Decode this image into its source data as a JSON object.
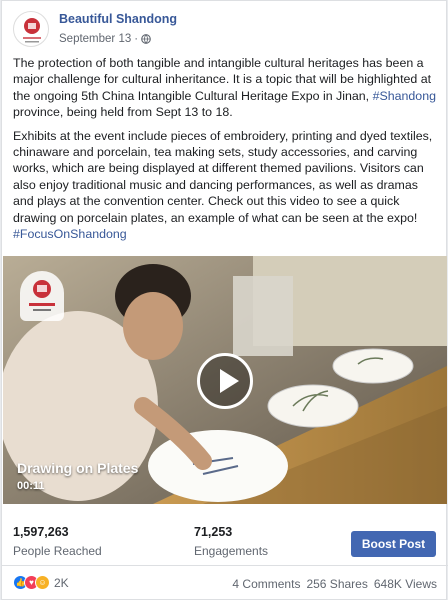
{
  "post": {
    "page_name": "Beautiful Shandong",
    "date": "September 13",
    "separator": "·",
    "avatar_label": "Shandong China",
    "paragraph1_a": "The protection of both tangible and intangible cultural heritages has been a major challenge for cultural inheritance. It is a topic that will be highlighted at the ongoing 5th China Intangible Cultural Heritage Expo in Jinan, ",
    "paragraph1_tag": "#Shandong",
    "paragraph1_b": " province, being held from Sept 13 to 18.",
    "paragraph2_a": "Exhibits at the event include pieces of embroidery, printing and dyed textiles, chinaware and porcelain, tea making sets, study accessories, and carving works, which are being displayed at different themed pavilions. Visitors can also enjoy traditional music and dancing performances, as well as dramas and plays at the convention center. Check out this video to see a quick drawing on porcelain plates, an example of what can be seen at the expo! ",
    "paragraph2_tag": "#FocusOnShandong"
  },
  "video": {
    "title": "Drawing on Plates",
    "duration": "00:11"
  },
  "stats": {
    "reached_value": "1,597,263",
    "reached_label": "People Reached",
    "engagements_value": "71,253",
    "engagements_label": "Engagements",
    "boost_label": "Boost Post"
  },
  "footer": {
    "reaction_count": "2K",
    "comments": "4 Comments",
    "shares": "256 Shares",
    "views": "648K Views"
  },
  "colors": {
    "link": "#385898",
    "button": "#4267b2",
    "like": "#1877f2",
    "love": "#f33e58",
    "haha": "#f7b125"
  }
}
